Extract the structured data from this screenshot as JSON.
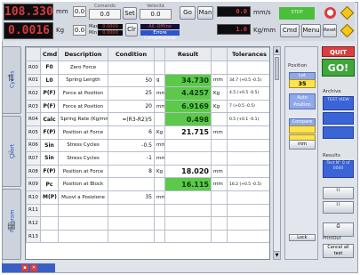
{
  "header": {
    "display1": {
      "value": "108.330",
      "unit": "mm",
      "offset": "0.0"
    },
    "display2": {
      "value": "0.0016",
      "unit": "Kg",
      "offset": "0.0"
    },
    "set_label": "Set",
    "set_value": "0.0",
    "set_top_label": "Comando",
    "velocity_top_label": "Velocità",
    "velocity_value": "0.0",
    "max_label": "Max",
    "min_label": "Min",
    "max_value": "0.0000",
    "min_value": "0.0000",
    "clr_label": "Clr",
    "go_label": "Go",
    "man_label": "Man",
    "mode_line1": "All. Offline",
    "mode_line2": "Errore Compressione",
    "speed_value": "0.0",
    "speed_unit": "mm/s",
    "stiff_value": "1.0",
    "stiff_unit": "Kg/mm",
    "status_label": "STOP",
    "cmd_label": "Cmd",
    "menu_label": "Menu",
    "reset_label": "Reset"
  },
  "left_tabs": [
    {
      "name": "Cycles"
    },
    {
      "name": "Chart"
    },
    {
      "name": "Program"
    }
  ],
  "table": {
    "headers": [
      "",
      "Cmd",
      "Description",
      "Condition",
      "",
      "Result",
      "",
      "Tolerances"
    ],
    "rows": [
      {
        "id": "R00",
        "cmd": "F0",
        "desc": "Zero Force",
        "cond": "",
        "cunit": "",
        "res": "",
        "runit": "",
        "tol": "",
        "green": false
      },
      {
        "id": "R01",
        "cmd": "L0",
        "desc": "Spring Length",
        "cond": "50",
        "cunit": "g",
        "res": "34.730",
        "runit": "mm",
        "tol": "34.7 (+0.5 -0.5)",
        "green": true
      },
      {
        "id": "R02",
        "cmd": "P(F)",
        "desc": "Force at Position",
        "cond": "25",
        "cunit": "mm",
        "res": "4.4257",
        "runit": "Kg",
        "tol": "4.5 (+0.5 -0.5)",
        "green": true
      },
      {
        "id": "R03",
        "cmd": "P(F)",
        "desc": "Force at Position",
        "cond": "20",
        "cunit": "mm",
        "res": "6.9169",
        "runit": "Kg",
        "tol": "7 (+0.5 -0.5)",
        "green": true
      },
      {
        "id": "R04",
        "cmd": "Calc",
        "desc": "Spring Rate (Kg/mm)",
        "cond": "=(R3-R2)/5",
        "cunit": "",
        "res": "0.498",
        "runit": "",
        "tol": "0.5 (+0.1 -0.1)",
        "green": true
      },
      {
        "id": "R05",
        "cmd": "F(P)",
        "desc": "Position at Force",
        "cond": "6",
        "cunit": "Kg",
        "res": "21.715",
        "runit": "mm",
        "tol": "",
        "green": false
      },
      {
        "id": "R06",
        "cmd": "Sin",
        "desc": "Stress Cycles",
        "cond": "-0.5",
        "cunit": "mm",
        "res": "",
        "runit": "",
        "tol": "",
        "green": false
      },
      {
        "id": "R07",
        "cmd": "Sin",
        "desc": "Stress Cycles",
        "cond": "-1",
        "cunit": "mm",
        "res": "",
        "runit": "",
        "tol": "",
        "green": false
      },
      {
        "id": "R08",
        "cmd": "F(P)",
        "desc": "Position at Force",
        "cond": "8",
        "cunit": "Kg",
        "res": "18.020",
        "runit": "mm",
        "tol": "",
        "green": false
      },
      {
        "id": "R09",
        "cmd": "Pc",
        "desc": "Position at Block",
        "cond": "",
        "cunit": "",
        "res": "16.115",
        "runit": "mm",
        "tol": "16.2 (+0.5 -0.5)",
        "green": true
      },
      {
        "id": "R10",
        "cmd": "M(P)",
        "desc": "Muovi a Posizione",
        "cond": "35",
        "cunit": "mm",
        "res": "",
        "runit": "",
        "tol": "",
        "green": false
      },
      {
        "id": "R11",
        "cmd": "",
        "desc": "",
        "cond": "",
        "cunit": "",
        "res": "",
        "runit": "",
        "tol": "",
        "green": false
      },
      {
        "id": "R12",
        "cmd": "",
        "desc": "",
        "cond": "",
        "cunit": "",
        "res": "",
        "runit": "",
        "tol": "",
        "green": false
      },
      {
        "id": "R13",
        "cmd": "",
        "desc": "",
        "cond": "",
        "cunit": "",
        "res": "",
        "runit": "",
        "tol": "",
        "green": false
      }
    ]
  },
  "position_panel": {
    "title": "Position",
    "slot_label": "Lot",
    "value": "35",
    "auto_label": "Auto Position",
    "compare_label": "Compare",
    "mm_label": "mm",
    "lock_label": "Lock"
  },
  "right_panel": {
    "quit_label": "QUIT",
    "go_label": "GO!",
    "archive_label": "Archive",
    "archive_item": "TEST VIEW",
    "results_label": "Results",
    "results_text": "Test N° 0 of 0000",
    "print_label": "PrintOut",
    "cancel_label": "Cancel all test",
    "icons": [
      "spring-icon",
      "spring-icon",
      "printer-icon"
    ]
  },
  "taskbar": {
    "items": [
      "save",
      "close"
    ]
  },
  "colors": {
    "lcd_text": "#d83a3a",
    "result_green": "#5cc94a",
    "quit_red": "#d93f3f",
    "go_green": "#3ea83a",
    "accent_blue": "#2d55c9"
  }
}
